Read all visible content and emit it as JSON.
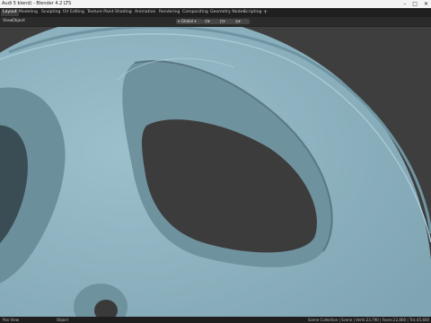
{
  "window": {
    "title": "Audi 5 blend) - Blender 4.2 LTS"
  },
  "workspace_tabs": [
    {
      "label": "Layout",
      "active": true
    },
    {
      "label": "Modeling"
    },
    {
      "label": "Sculpting"
    },
    {
      "label": "UV Editing"
    },
    {
      "label": "Texture Paint"
    },
    {
      "label": "Shading"
    },
    {
      "label": "Animation"
    },
    {
      "label": "Rendering"
    },
    {
      "label": "Compositing"
    },
    {
      "label": "Geometry Nodes"
    },
    {
      "label": "Scripting"
    }
  ],
  "scene": {
    "label": "Scene"
  },
  "header": {
    "view": "View",
    "object": "Object",
    "transform_orientation": "Global"
  },
  "status_bar": {
    "left": "Pan View",
    "middle": "Object",
    "right": "Scene Collection | Scene | Verts:23,790 | Faces:22,800 | Tris:45,600"
  },
  "colors": {
    "rim": "#8fb2bf",
    "rim_shadow": "#5f808c",
    "background": "#3e3e3e"
  }
}
